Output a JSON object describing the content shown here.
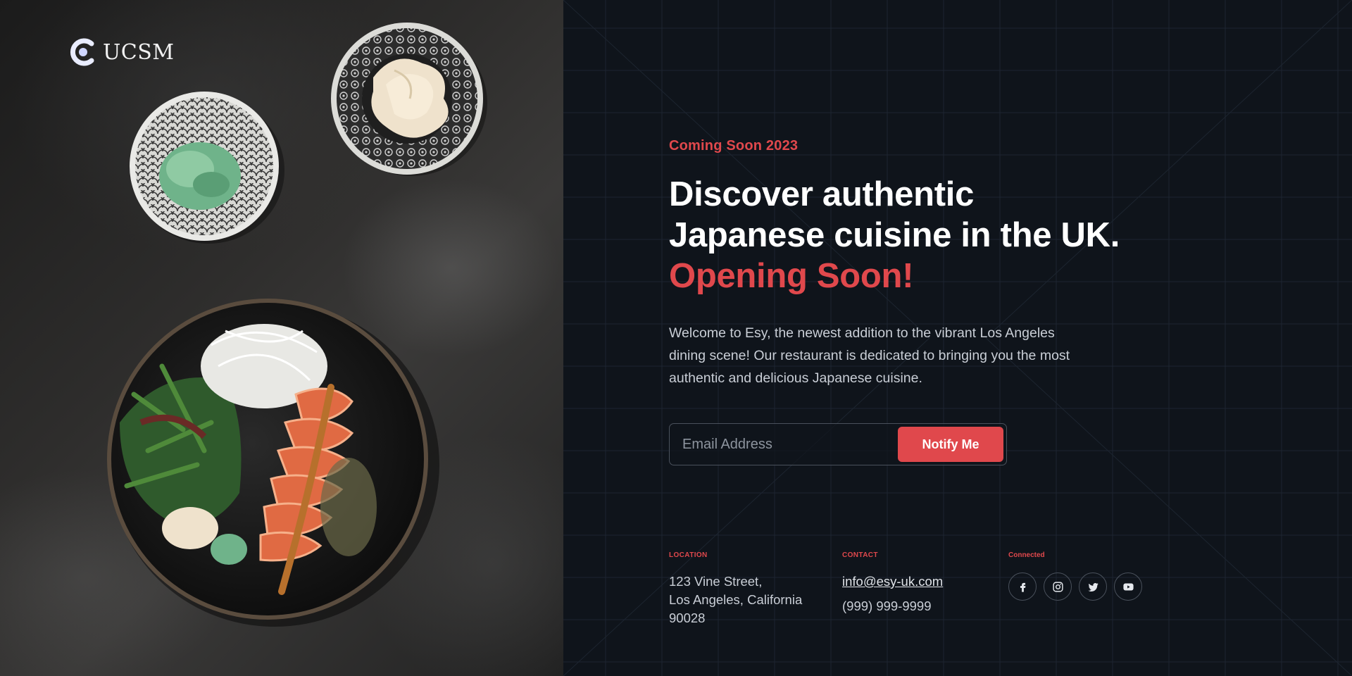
{
  "brand": {
    "name": "UCSM",
    "logo_icon": "ucsm-logo-icon"
  },
  "hero": {
    "eyebrow": "Coming Soon 2023",
    "headline_main": "Discover authentic Japanese cuisine in the UK.",
    "headline_accent": "Opening Soon!",
    "description": "Welcome to Esy, the newest addition to the vibrant Los Angeles dining scene! Our restaurant is dedicated to bringing you the most authentic and delicious Japanese cuisine."
  },
  "subscribe": {
    "email_placeholder": "Email Address",
    "email_value": "",
    "button_label": "Notify Me"
  },
  "footer": {
    "location": {
      "label": "LOCATION",
      "line1": "123 Vine Street,",
      "line2": "Los Angeles, California",
      "line3": "90028"
    },
    "contact": {
      "label": "CONTACT",
      "email": "info@esy-uk.com",
      "phone": "(999) 999-9999"
    },
    "connected": {
      "label": "Connected",
      "icons": [
        "facebook-icon",
        "instagram-icon",
        "twitter-icon",
        "youtube-icon"
      ]
    }
  },
  "colors": {
    "accent": "#e0484c",
    "background": "#0f141b",
    "text_muted": "#c9ced6"
  }
}
